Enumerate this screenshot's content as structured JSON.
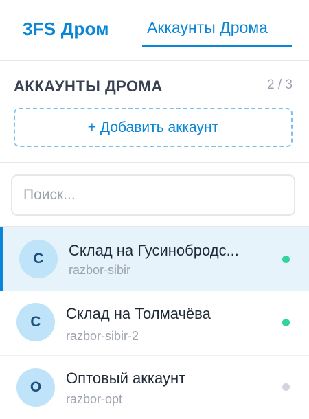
{
  "header": {
    "brand": "3FS Дром",
    "nav_tab": "Аккаунты Дрома"
  },
  "section": {
    "title": "АККАУНТЫ ДРОМА",
    "count": "2 / 3",
    "add_button": "+ Добавить аккаунт"
  },
  "search": {
    "placeholder": "Поиск...",
    "value": ""
  },
  "accounts": [
    {
      "initial": "С",
      "name": "Склад на Гусинобродс...",
      "login": "razbor-sibir",
      "status": "active",
      "status_color": "#34d399",
      "selected": true
    },
    {
      "initial": "С",
      "name": "Склад на Толмачёва",
      "login": "razbor-sibir-2",
      "status": "active",
      "status_color": "#34d399",
      "selected": false
    },
    {
      "initial": "О",
      "name": "Оптовый аккаунт",
      "login": "razbor-opt",
      "status": "inactive",
      "status_color": "#d1d5db",
      "selected": false
    }
  ],
  "colors": {
    "accent": "#0a86d6",
    "selected_bg": "#e6f3fb",
    "avatar_bg": "#bfe3f8"
  }
}
